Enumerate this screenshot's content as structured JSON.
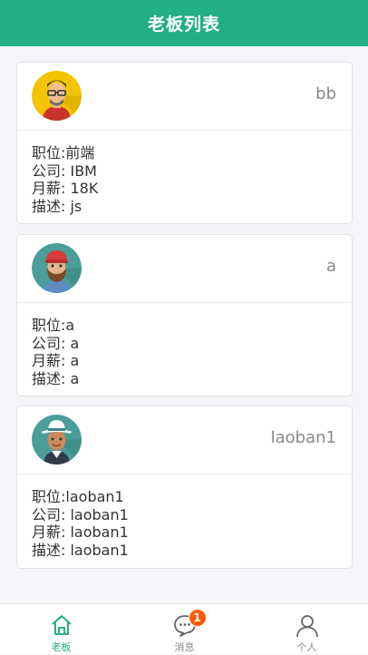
{
  "header": {
    "title": "老板列表"
  },
  "bosses": [
    {
      "name": "bb",
      "position_label": "职位:",
      "position": "前端",
      "company_label": "公司: ",
      "company": "IBM",
      "salary_label": "月薪: ",
      "salary": "18K",
      "desc_label": "描述: ",
      "desc": "js",
      "avatar": "avatar-glasses-icon"
    },
    {
      "name": "a",
      "position_label": "职位:",
      "position": "a",
      "company_label": "公司: ",
      "company": "a",
      "salary_label": "月薪: ",
      "salary": "a",
      "desc_label": "描述: ",
      "desc": "a",
      "avatar": "avatar-cap-beard-icon"
    },
    {
      "name": "laoban1",
      "position_label": "职位:",
      "position": "laoban1",
      "company_label": "公司: ",
      "company": "laoban1",
      "salary_label": "月薪: ",
      "salary": "laoban1",
      "desc_label": "描述: ",
      "desc": "laoban1",
      "avatar": "avatar-hat-icon"
    }
  ],
  "tabbar": {
    "boss_label": "老板",
    "msg_label": "消息",
    "me_label": "个人",
    "msg_badge": "1"
  },
  "colors": {
    "accent": "#24ae85",
    "badge": "#ff5b05"
  }
}
